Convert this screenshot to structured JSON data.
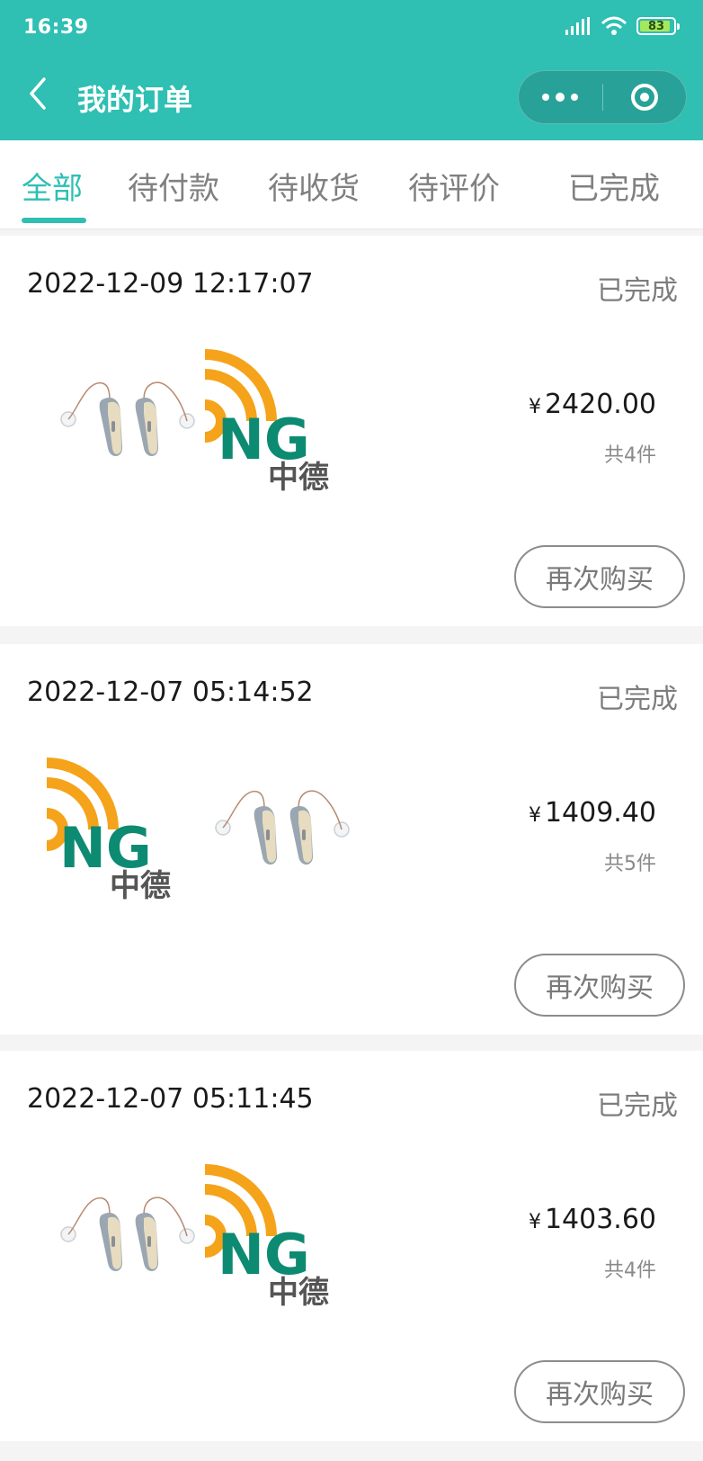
{
  "status_bar": {
    "time": "16:39",
    "battery": "83"
  },
  "header": {
    "title": "我的订单",
    "back_icon": "chevron-left-icon",
    "more_icon": "more-dots-icon",
    "close_icon": "target-ring-icon",
    "color": "#2fbfb3"
  },
  "tabs": [
    {
      "label": "全部",
      "active": true
    },
    {
      "label": "待付款",
      "active": false
    },
    {
      "label": "待收货",
      "active": false
    },
    {
      "label": "待评价",
      "active": false
    },
    {
      "label": "已完成",
      "active": false
    }
  ],
  "orders": [
    {
      "datetime": "2022-12-09 12:17:07",
      "status": "已完成",
      "currency": "¥",
      "amount": "2420.00",
      "count": "共4件",
      "rebuy": "再次购买",
      "images": [
        "hearing-aid-image",
        "logo-image"
      ]
    },
    {
      "datetime": "2022-12-07 05:14:52",
      "status": "已完成",
      "currency": "¥",
      "amount": "1409.40",
      "count": "共5件",
      "rebuy": "再次购买",
      "images": [
        "logo-image",
        "hearing-aid-image"
      ]
    },
    {
      "datetime": "2022-12-07 05:11:45",
      "status": "已完成",
      "currency": "¥",
      "amount": "1403.60",
      "count": "共4件",
      "rebuy": "再次购买",
      "images": [
        "hearing-aid-image",
        "logo-image"
      ]
    }
  ],
  "logo": {
    "text": "NG",
    "subtext": "中德",
    "orange": "#f5a31a",
    "green": "#0d8a72"
  }
}
